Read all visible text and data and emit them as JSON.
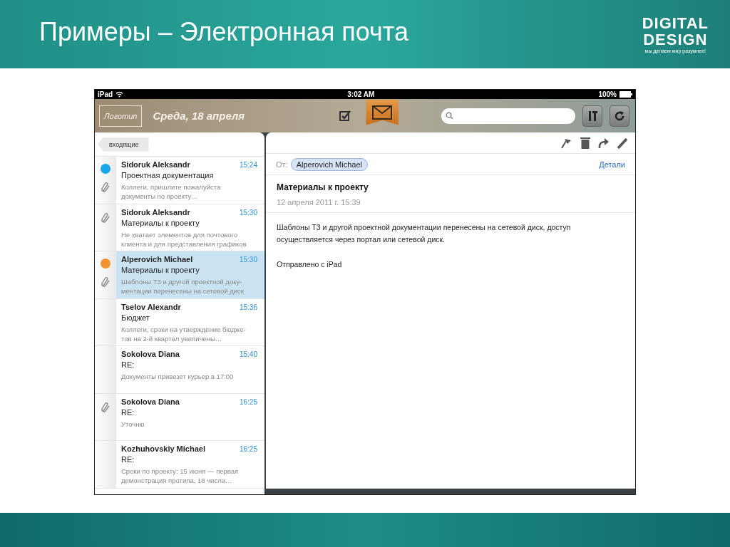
{
  "slide": {
    "title": "Примеры – Электронная почта",
    "logo": {
      "line1": "DIGITAL",
      "line2": "DESIGN",
      "tagline": "мы делаем мир разумнее!"
    }
  },
  "status_bar": {
    "device": "iPad",
    "time": "3:02 AM",
    "battery": "100%"
  },
  "toolbar": {
    "logo": "Логотип",
    "date": "Среда, 18 апреля",
    "tabs": [
      {
        "kind": "tasks",
        "selected": false
      },
      {
        "kind": "mail",
        "selected": true
      }
    ]
  },
  "mailbox": {
    "back": "входящие"
  },
  "messages": [
    {
      "sender": "Sidoruk Aleksandr",
      "time": "15:24",
      "subject": "Проектная документация",
      "preview": "Коллеги, пришлите пожалуйста документы по проекту…",
      "color": "#1aa7ec",
      "attachment": true,
      "selected": false
    },
    {
      "sender": "Sidoruk Aleksandr",
      "time": "15:30",
      "subject": "Материалы к проекту",
      "preview": "Не хватает элементов для почтового клиента и для представления графиков",
      "attachment": true,
      "selected": false
    },
    {
      "sender": "Alperovich Michael",
      "time": "15:30",
      "subject": "Материалы к проекту",
      "preview": "Шаблоны Т3 и другой проектной доку-ментации перенесены на сетевой диск",
      "color": "#f39331",
      "attachment": true,
      "selected": true
    },
    {
      "sender": "Tselov Alexandr",
      "time": "15:36",
      "subject": "Бюджет",
      "preview": "Коллеги, сроки на утверждение бюдже-тов на 2-й квартал увеличены…",
      "attachment": false,
      "selected": false
    },
    {
      "sender": "Sokolova Diana",
      "time": "15:40",
      "subject": "RE:",
      "preview": "Документы привезет курьер в 17:00",
      "attachment": false,
      "selected": false
    },
    {
      "sender": "Sokolova Diana",
      "time": "16:25",
      "subject": "RE:",
      "preview": "Уточню",
      "attachment": true,
      "selected": false
    },
    {
      "sender": "Kozhuhovskiy Michael",
      "time": "16:25",
      "subject": "RE:",
      "preview": "Сроки по проекту: 15 июня — первая демонстрация протипа, 18 числа…",
      "attachment": false,
      "selected": false
    }
  ],
  "detail": {
    "from_label": "От:",
    "from": "Alperovich Michael",
    "details_link": "Детали",
    "subject": "Материалы к проекту",
    "date": "12 апреля 2011 г. 15:39",
    "body": [
      "Шаблоны Т3 и другой проектной документации перенесены на сетевой диск, доступ осуществляется через портал или сетевой диск.",
      "Отправлено с iPad"
    ]
  }
}
